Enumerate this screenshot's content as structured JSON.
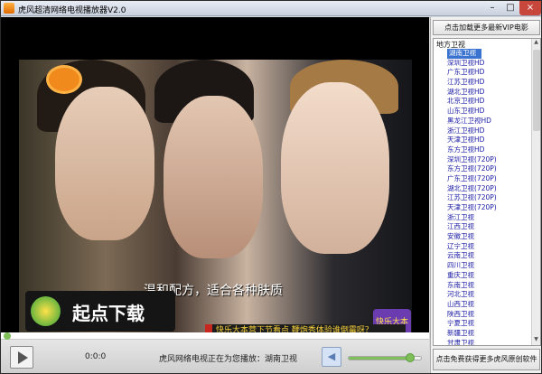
{
  "window": {
    "title": "虎风超清网络电视播放器V2.0"
  },
  "video": {
    "subtitle": "温和配方，适合各种肤质",
    "ticker": "快乐大本营下节看点  鞭炮秀体验谁倒霉呀？",
    "promo_badge": "快乐大本营",
    "watermark_text": "起点下载"
  },
  "controls": {
    "time": "0:0:0",
    "status": "虎风网络电视正在为您播放：湖南卫视",
    "progress": 0.0,
    "volume": 0.85
  },
  "panel": {
    "vip_button": "点击加载更多最新VIP电影",
    "category": "地方卫视",
    "channels": [
      "湖南卫视",
      "深圳卫视HD",
      "广东卫视HD",
      "江苏卫视HD",
      "湖北卫视HD",
      "北京卫视HD",
      "山东卫视HD",
      "黑龙江卫视HD",
      "浙江卫视HD",
      "天津卫视HD",
      "东方卫视HD",
      "深圳卫视(720P)",
      "东方卫视(720P)",
      "广东卫视(720P)",
      "湖北卫视(720P)",
      "江苏卫视(720P)",
      "天津卫视(720P)",
      "浙江卫视",
      "江西卫视",
      "安徽卫视",
      "辽宁卫视",
      "云南卫视",
      "四川卫视",
      "重庆卫视",
      "东南卫视",
      "河北卫视",
      "山西卫视",
      "陕西卫视",
      "宁夏卫视",
      "新疆卫视",
      "甘肃卫视",
      "青海卫视"
    ],
    "selected_index": 0,
    "free_button": "点击免费获得更多虎风原创软件"
  }
}
